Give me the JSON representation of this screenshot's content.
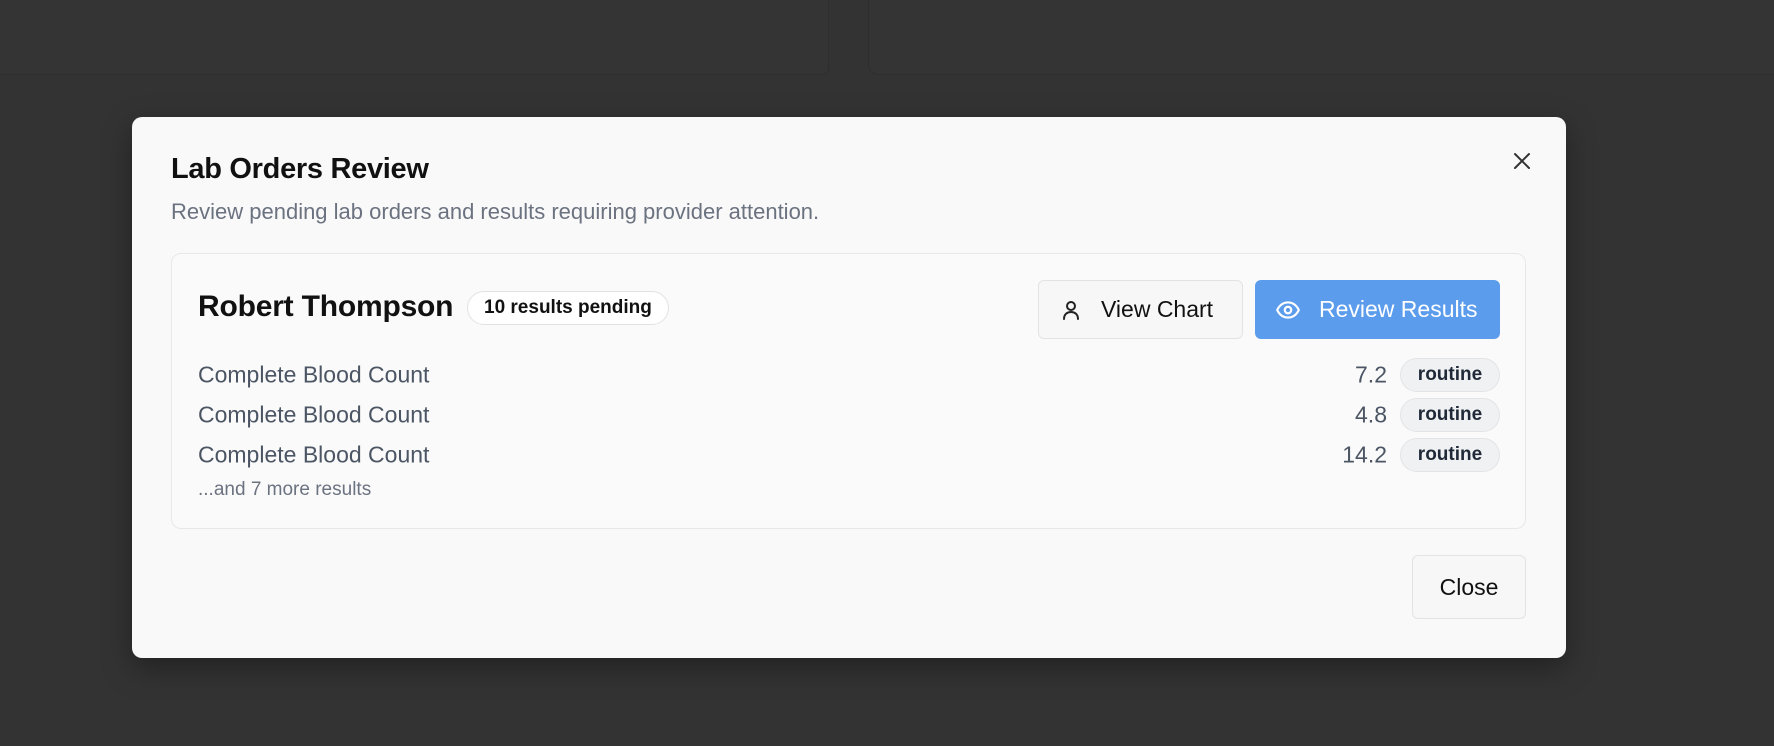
{
  "dialog": {
    "title": "Lab Orders Review",
    "description": "Review pending lab orders and results requiring provider attention.",
    "close_icon": "close-icon"
  },
  "patient": {
    "name": "Robert Thompson",
    "pending_badge": "10 results pending",
    "view_chart_label": "View Chart",
    "view_chart_icon": "user-icon",
    "review_results_label": "Review Results",
    "review_results_icon": "eye-icon",
    "results": [
      {
        "name": "Complete Blood Count",
        "value": "7.2",
        "priority": "routine"
      },
      {
        "name": "Complete Blood Count",
        "value": "4.8",
        "priority": "routine"
      },
      {
        "name": "Complete Blood Count",
        "value": "14.2",
        "priority": "routine"
      }
    ],
    "more_text": "...and 7 more results"
  },
  "footer": {
    "close_label": "Close"
  },
  "colors": {
    "backdrop": "#333333",
    "dialog_bg": "#f9f9f9",
    "primary_button": "#5b9cec",
    "muted_text": "#6b7280"
  }
}
